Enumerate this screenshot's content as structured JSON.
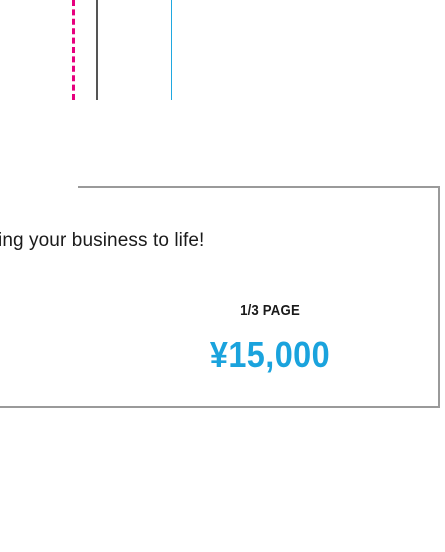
{
  "ad": {
    "tagline": "ing your business to life!",
    "size_label": "1/3 PAGE",
    "price": "¥15,000"
  },
  "colors": {
    "accent_blue": "#1aa3dd",
    "guide_magenta": "#e6007e",
    "border_gray": "#9a9a9a"
  }
}
